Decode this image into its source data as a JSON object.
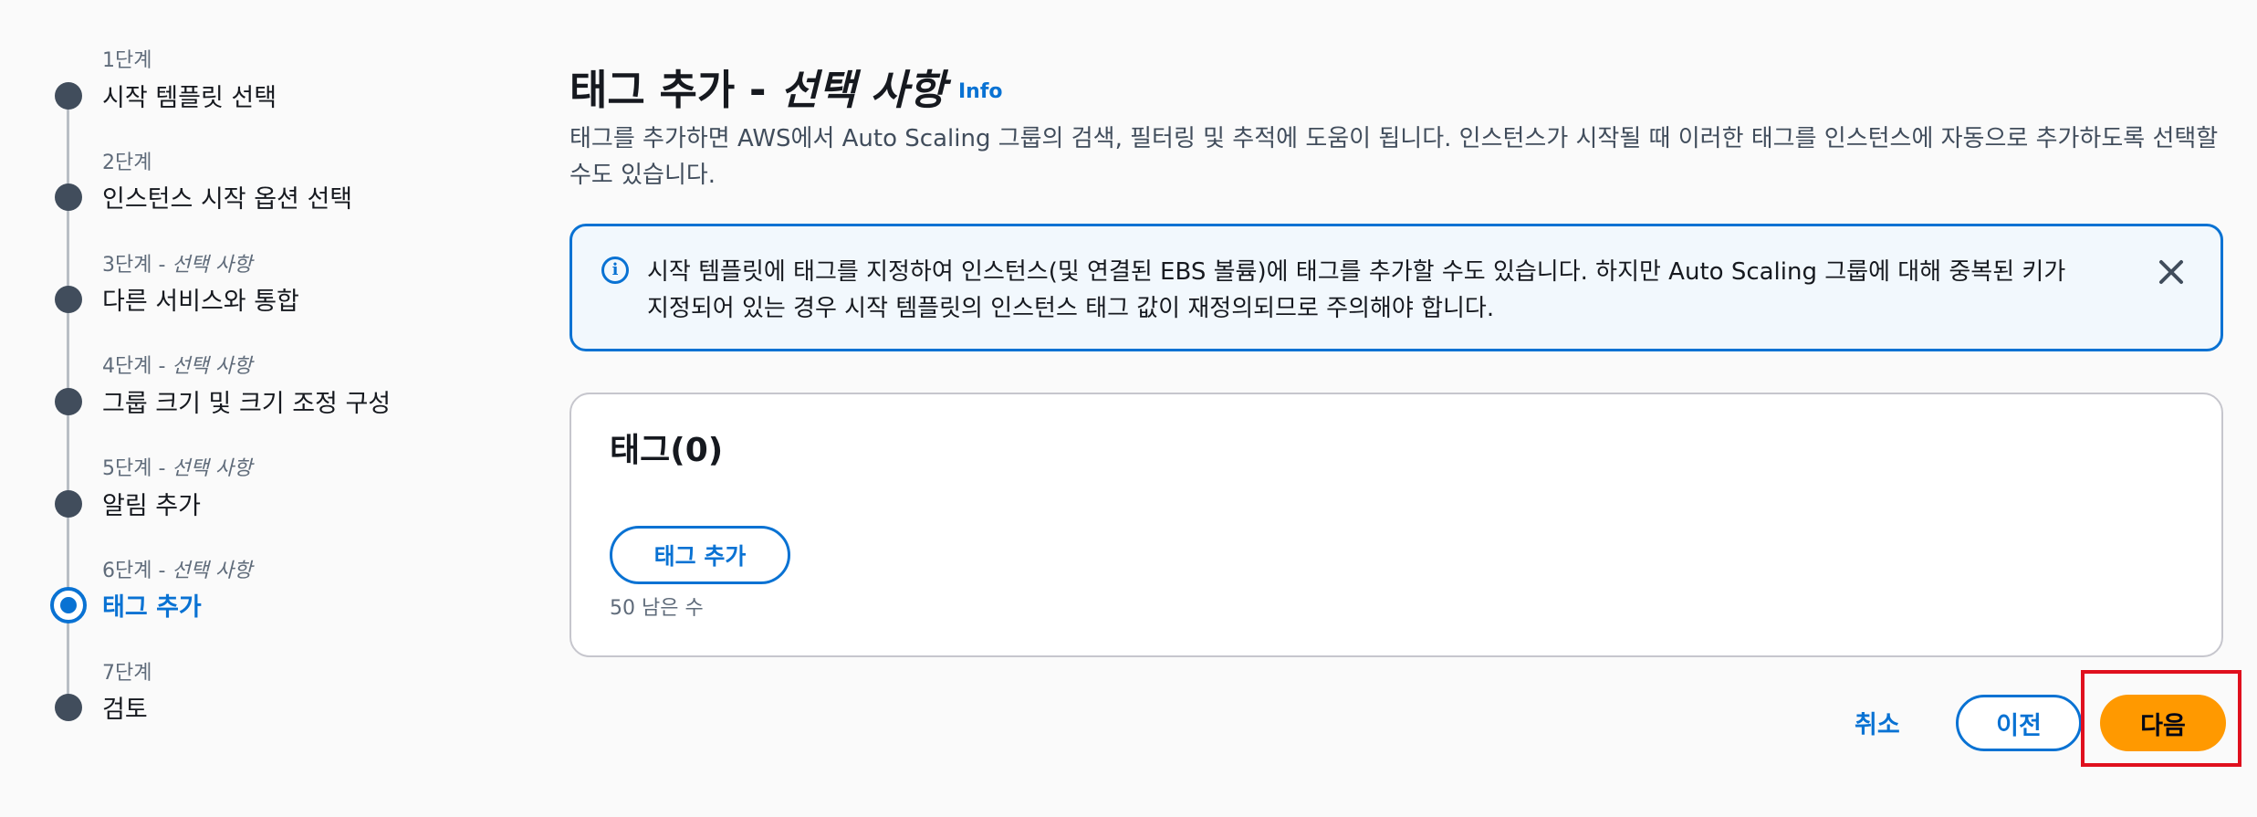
{
  "wizard": {
    "steps": [
      {
        "num": "1단계",
        "optional": "",
        "title": "시작 템플릿 선택"
      },
      {
        "num": "2단계",
        "optional": "",
        "title": "인스턴스 시작 옵션 선택"
      },
      {
        "num": "3단계",
        "optional": "선택 사항",
        "title": "다른 서비스와 통합"
      },
      {
        "num": "4단계",
        "optional": "선택 사항",
        "title": "그룹 크기 및 크기 조정 구성"
      },
      {
        "num": "5단계",
        "optional": "선택 사항",
        "title": "알림 추가"
      },
      {
        "num": "6단계",
        "optional": "선택 사항",
        "title": "태그 추가"
      },
      {
        "num": "7단계",
        "optional": "",
        "title": "검토"
      }
    ],
    "separator": " - ",
    "active_index": 5
  },
  "header": {
    "title_main": "태그 추가 - ",
    "title_optional": "선택 사항",
    "info_label": "Info",
    "description": "태그를 추가하면 AWS에서 Auto Scaling 그룹의 검색, 필터링 및 추적에 도움이 됩니다. 인스턴스가 시작될 때 이러한 태그를 인스턴스에 자동으로 추가하도록 선택할 수도 있습니다."
  },
  "alert": {
    "text": "시작 템플릿에 태그를 지정하여 인스턴스(및 연결된 EBS 볼륨)에 태그를 추가할 수도 있습니다. 하지만 Auto Scaling 그룹에 대해 중복된 키가 지정되어 있는 경우 시작 템플릿의 인스턴스 태그 값이 재정의되므로 주의해야 합니다.",
    "icon": "info-icon"
  },
  "tags_card": {
    "title": "태그(0)",
    "add_button": "태그 추가",
    "remaining": "50 남은 수"
  },
  "footer": {
    "cancel": "취소",
    "previous": "이전",
    "next": "다음"
  },
  "colors": {
    "accent": "#0972d3",
    "primary_button": "#ff9900",
    "highlight": "#e0101e"
  }
}
